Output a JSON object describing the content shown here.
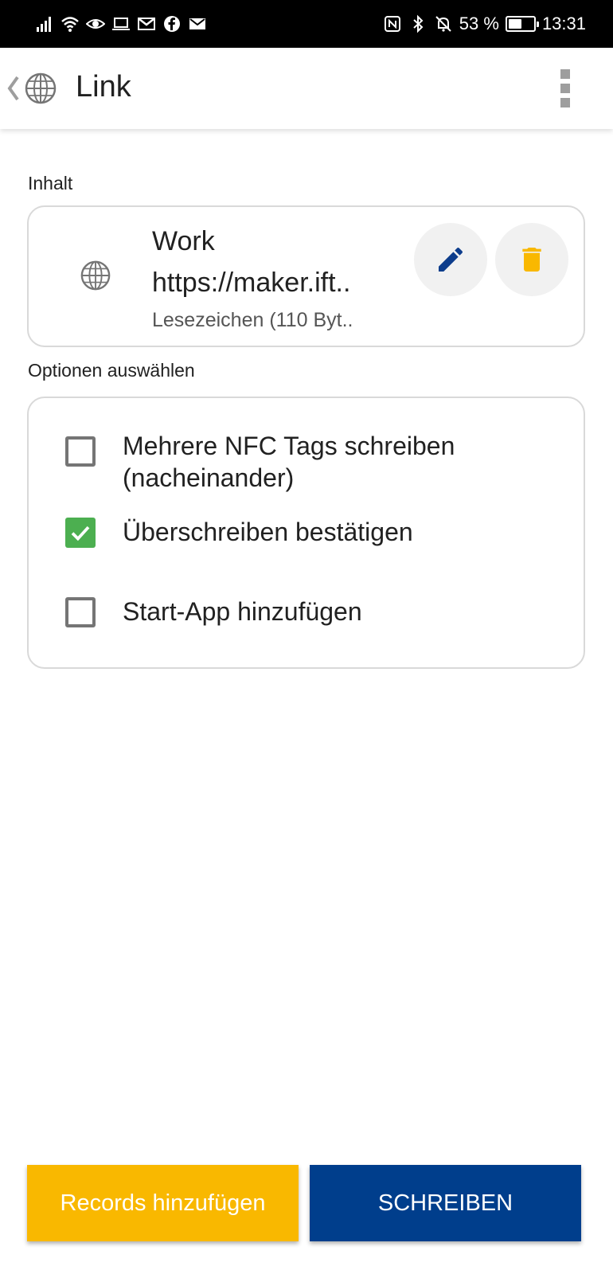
{
  "status_bar": {
    "battery_percent": "53 %",
    "battery_level": 0.53,
    "time": "13:31",
    "left_icons": [
      "signal-icon",
      "wifi-icon",
      "eye-icon",
      "laptop-icon",
      "gmail-icon",
      "facebook-icon",
      "mail-icon"
    ],
    "right_icons": [
      "nfc-icon",
      "bluetooth-icon",
      "notifications-off-icon",
      "battery-icon"
    ]
  },
  "toolbar": {
    "title": "Link",
    "icon": "globe-icon"
  },
  "content_section": {
    "label": "Inhalt",
    "record": {
      "icon": "globe-icon",
      "title": "Work",
      "url": "https://maker.ift..",
      "subtitle": "Lesezeichen (110 Byt.."
    },
    "colors": {
      "edit_icon": "#0d3d8c",
      "delete_icon": "#f9b800"
    }
  },
  "options_section": {
    "label": "Optionen auswählen",
    "options": [
      {
        "label": "Mehrere NFC Tags schreiben (nacheinander)",
        "checked": false
      },
      {
        "label": "Überschreiben bestätigen",
        "checked": true
      },
      {
        "label": "Start-App hinzufügen",
        "checked": false
      }
    ]
  },
  "buttons": {
    "records_label": "Records hinzufügen",
    "write_label": "SCHREIBEN"
  },
  "colors": {
    "accent_yellow": "#f9b800",
    "accent_blue": "#003e8c",
    "check_green": "#4caf50"
  }
}
